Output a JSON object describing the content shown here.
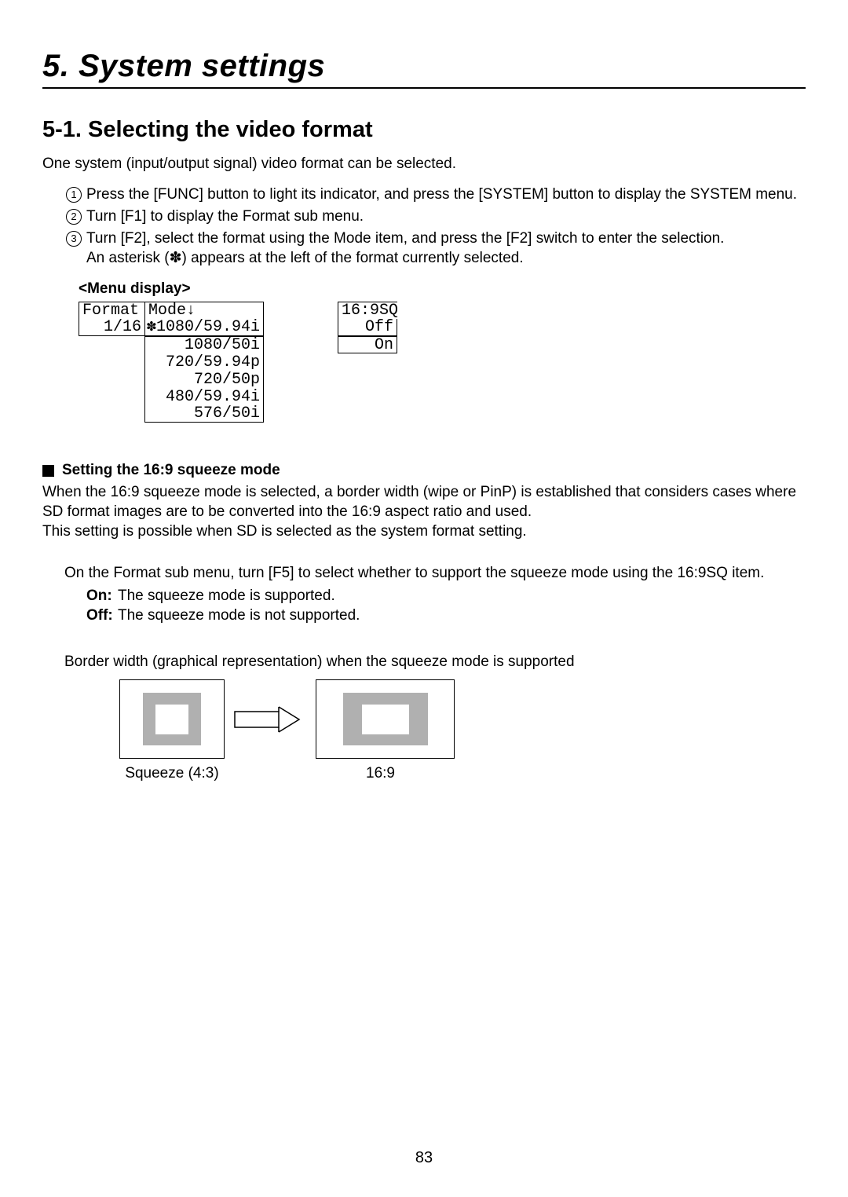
{
  "chapter": {
    "number": "5.",
    "title": "System settings"
  },
  "section": {
    "number": "5-1.",
    "title": "Selecting the video format"
  },
  "intro": "One system (input/output signal) video format can be selected.",
  "steps": [
    "Press the [FUNC] button to light its indicator, and press the [SYSTEM] button to display the SYSTEM menu.",
    "Turn [F1] to display the Format sub menu.",
    "Turn [F2], select the format using the Mode item, and press the [F2] switch to enter the selection.\nAn asterisk (✽) appears at the left of the format currently selected."
  ],
  "menu_label": "<Menu display>",
  "menu": {
    "header": {
      "format": "Format",
      "mode": "Mode↓",
      "sq": "16:9SQ"
    },
    "row": {
      "page": "1/16",
      "mode": "✽1080/59.94i",
      "sq": "Off"
    },
    "options": [
      "1080/50i",
      "720/59.94p",
      "720/50p",
      "480/59.94i",
      "576/50i"
    ],
    "sq_options": [
      "On"
    ]
  },
  "squeeze": {
    "heading": "Setting the 16:9 squeeze mode",
    "body": "When the 16:9 squeeze mode is selected, a border width (wipe or PinP) is established that considers cases where SD format images are to be converted into the 16:9 aspect ratio and used.\nThis setting is possible when SD is selected as the system format setting.",
    "instruction": "On the Format sub menu, turn [F5] to select whether to support the squeeze mode using the 16:9SQ item.",
    "on_label": "On:",
    "on_text": "The squeeze mode is supported.",
    "off_label": "Off:",
    "off_text": "The squeeze mode is not supported.",
    "caption": "Border width (graphical representation) when the squeeze mode is supported",
    "label43": "Squeeze (4:3)",
    "label169": "16:9"
  },
  "page_number": "83"
}
